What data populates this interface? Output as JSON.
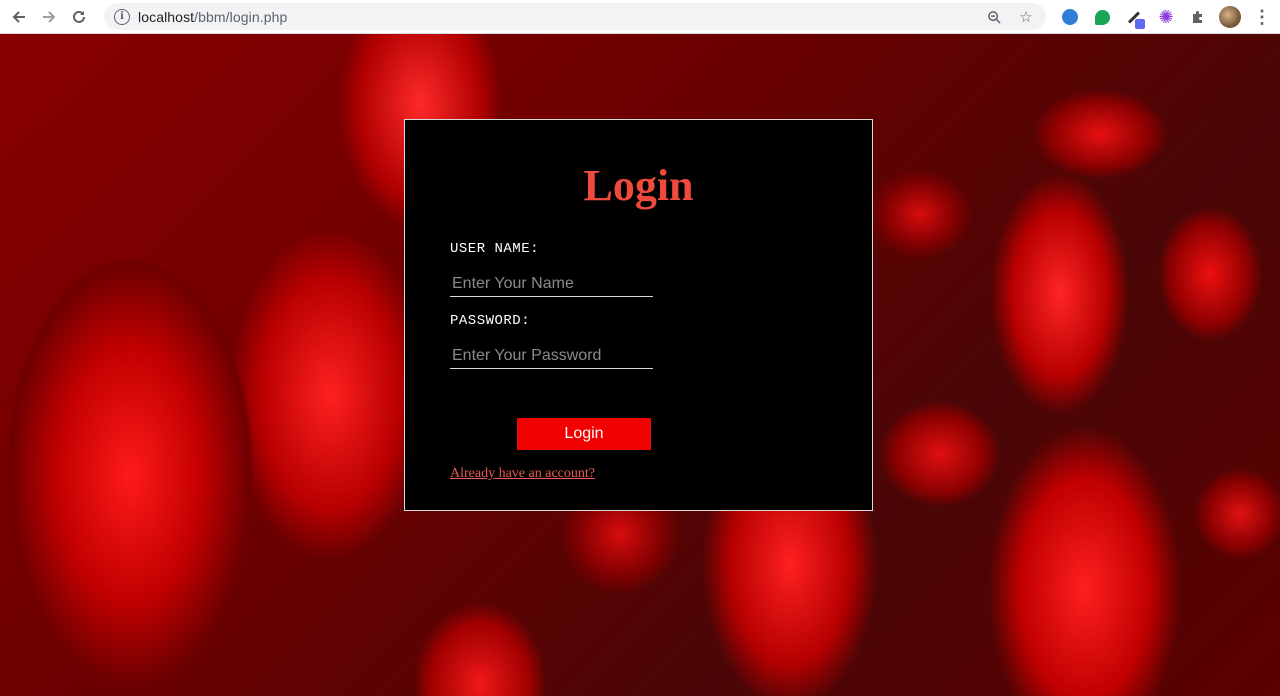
{
  "browser": {
    "url_host": "localhost",
    "url_path": "/bbm/login.php",
    "icons": {
      "back": "arrow-left-icon",
      "forward": "arrow-right-icon",
      "reload": "reload-icon",
      "site_info": "info-icon",
      "zoom": "zoom-icon",
      "bookmark": "star-icon",
      "extensions": "puzzle-icon",
      "menu": "kebab-menu-icon"
    }
  },
  "login": {
    "title": "Login",
    "username_label": "USER NAME:",
    "username_placeholder": "Enter Your Name",
    "username_value": "",
    "password_label": "PASSWORD:",
    "password_placeholder": "Enter Your Password",
    "password_value": "",
    "submit_label": "Login",
    "account_link": "Already have an account?"
  },
  "colors": {
    "title": "#ef4a3d",
    "button": "#f30000",
    "link": "#e85a4f",
    "card_bg": "#000000"
  }
}
